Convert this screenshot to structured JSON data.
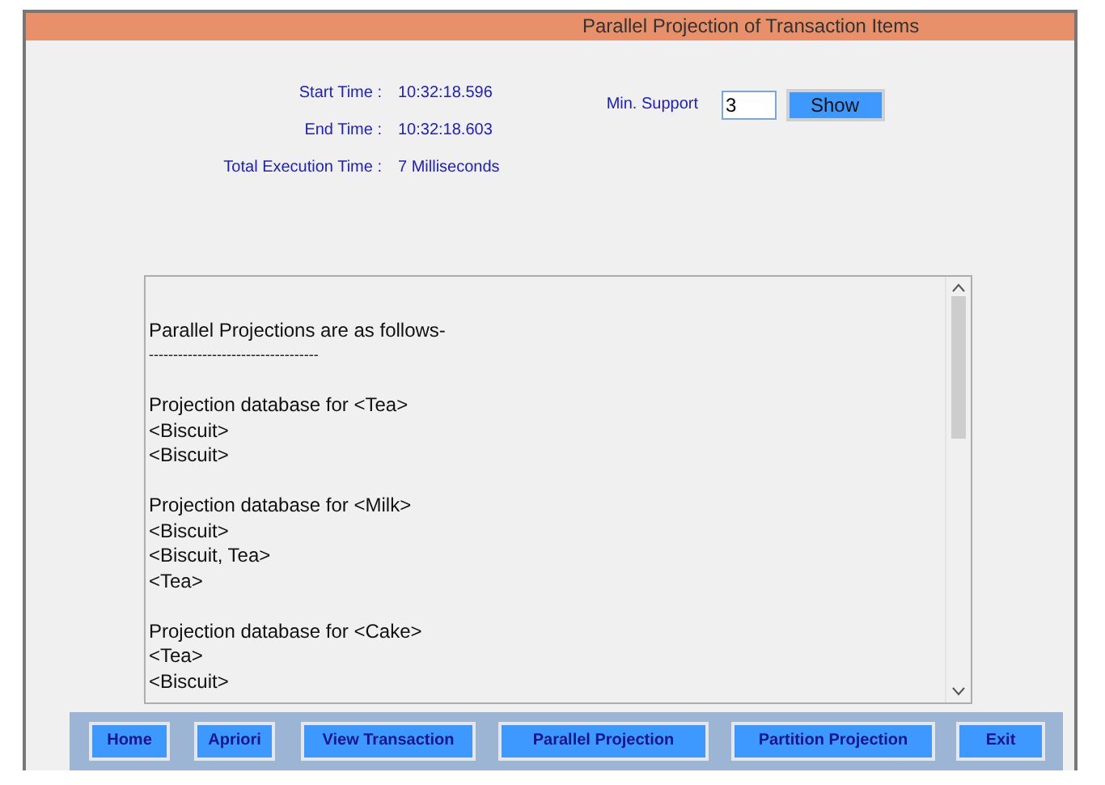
{
  "window": {
    "title": "Parallel Projection of Transaction Items"
  },
  "timing": [
    {
      "label": "Start Time :",
      "value": "10:32:18.596"
    },
    {
      "label": "End Time :",
      "value": "10:32:18.603"
    },
    {
      "label": "Total Execution Time :",
      "value": "7 Milliseconds"
    }
  ],
  "min_support": {
    "label": "Min. Support",
    "value": "3",
    "button": "Show"
  },
  "output": {
    "heading": "Parallel Projections are as follows-",
    "rule": "-----------------------------------",
    "blocks": [
      {
        "title": "Projection database for <Tea>",
        "lines": [
          "<Biscuit>",
          "<Biscuit>"
        ]
      },
      {
        "title": "Projection database for <Milk>",
        "lines": [
          "<Biscuit>",
          "<Biscuit, Tea>",
          "<Tea>"
        ]
      },
      {
        "title": "Projection database for <Cake>",
        "lines": [
          "<Tea>",
          "<Biscuit>"
        ]
      }
    ]
  },
  "buttons": [
    "Home",
    "Apriori",
    "View Transaction",
    "Parallel Projection",
    "Partition Projection",
    "Exit"
  ]
}
